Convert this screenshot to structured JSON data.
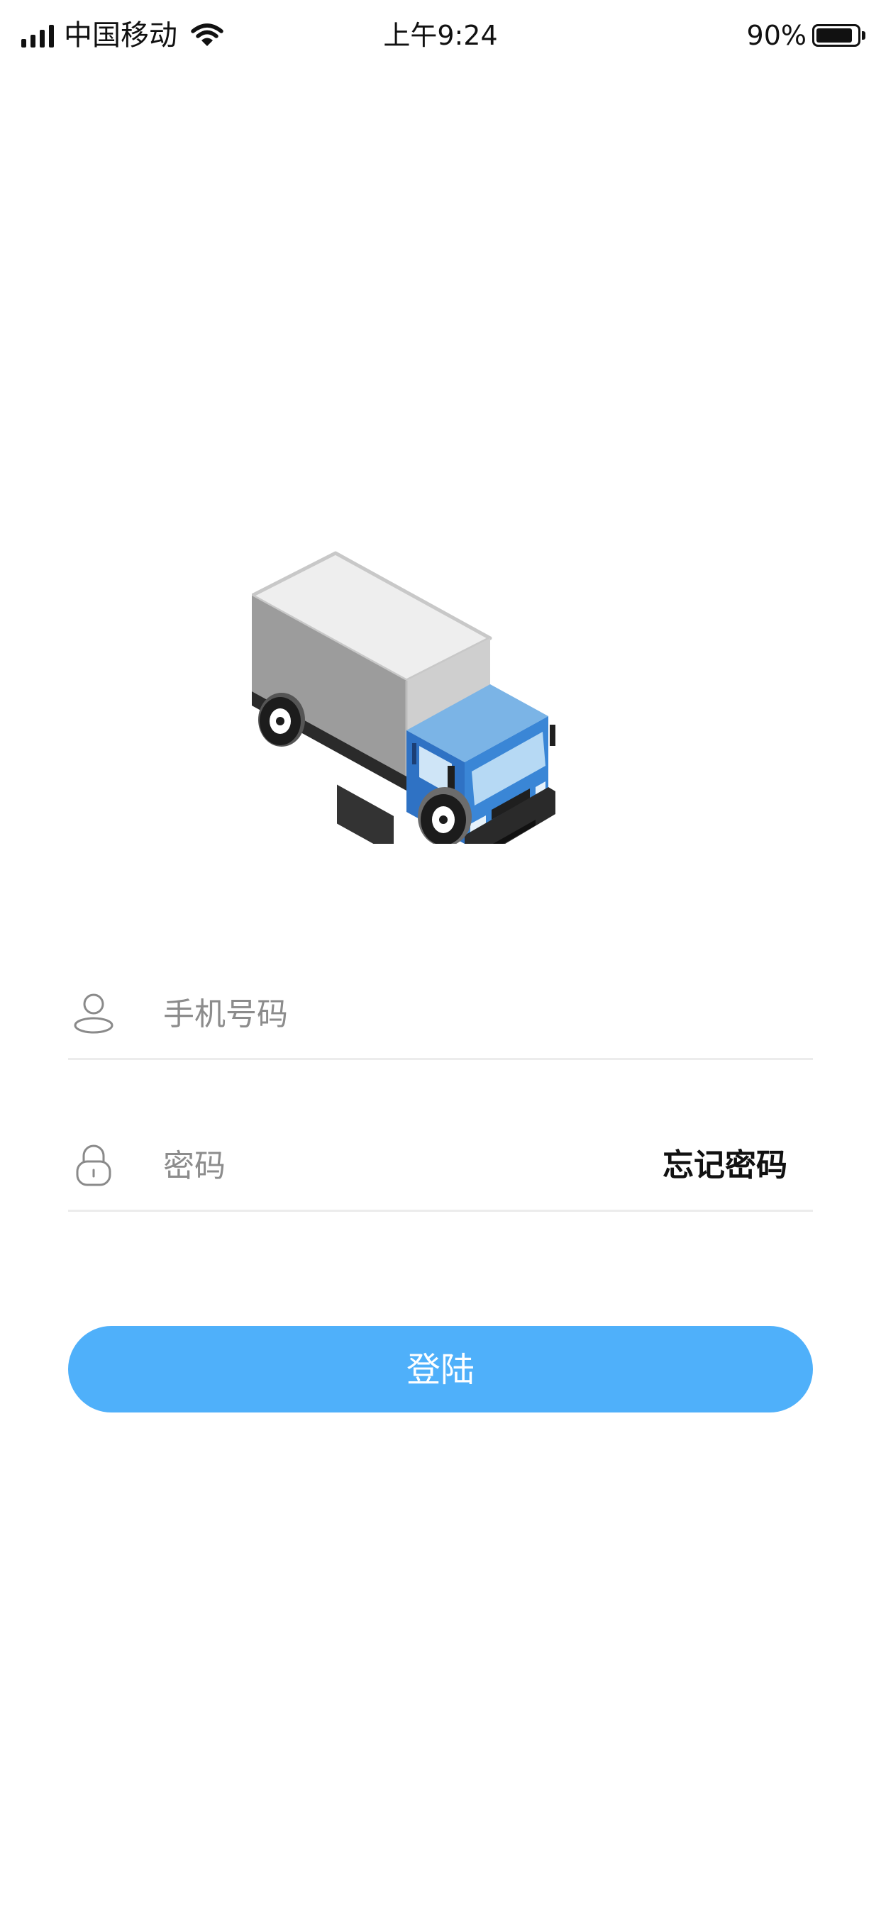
{
  "status_bar": {
    "carrier": "中国移动",
    "time": "上午9:24",
    "battery_percent": "90%",
    "battery_level": 0.9,
    "icons": [
      "signal-icon",
      "wifi-icon",
      "battery-icon"
    ]
  },
  "illustration": {
    "icon": "truck-icon"
  },
  "form": {
    "phone": {
      "icon": "user-icon",
      "placeholder": "手机号码",
      "value": ""
    },
    "password": {
      "icon": "lock-icon",
      "placeholder": "密码",
      "value": "",
      "forgot_label": "忘记密码"
    },
    "login_label": "登陆"
  },
  "colors": {
    "primary_button": "#4fb0fa",
    "truck_cab": "#2f72c4",
    "truck_cab_top": "#7bb4e6",
    "divider": "#ececec",
    "placeholder_text": "#8c8c8c"
  }
}
